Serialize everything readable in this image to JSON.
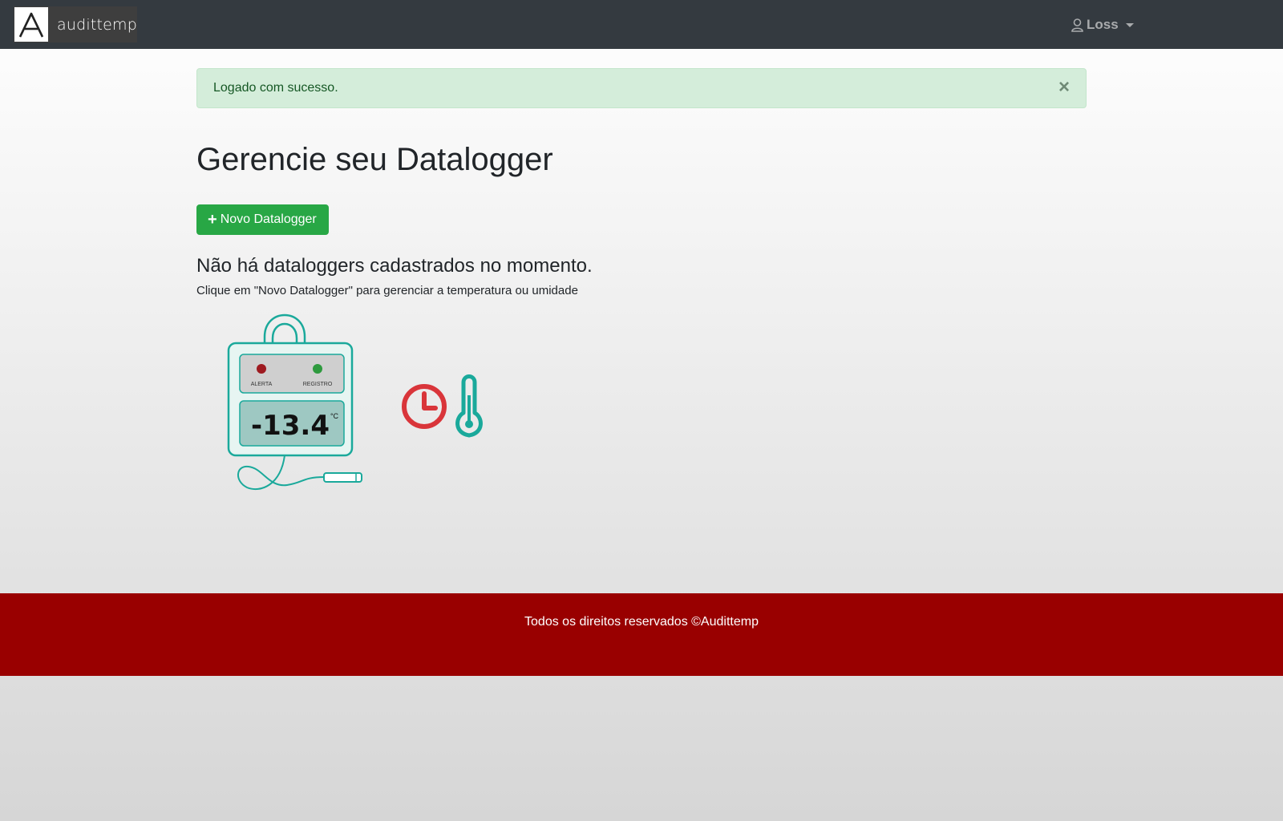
{
  "navbar": {
    "brand_name": "audittemp",
    "user_name": "Loss"
  },
  "alert": {
    "message": "Logado com sucesso.",
    "close_symbol": "×"
  },
  "main": {
    "title": "Gerencie seu Datalogger",
    "new_button_icon": "+",
    "new_button_label": "Novo Datalogger",
    "empty_title": "Não há dataloggers cadastrados no momento.",
    "empty_subtitle": "Clique em \"Novo Datalogger\" para gerenciar a temperatura ou umidade"
  },
  "illustration": {
    "alert_label": "ALERTA",
    "register_label": "REGISTRO",
    "display_value": "-13.4",
    "display_unit": "°C",
    "colors": {
      "teal": "#1aa99b",
      "red": "#d9353a",
      "green": "#2e9a3e",
      "dark_red": "#9e1a20"
    }
  },
  "footer": {
    "text": "Todos os direitos reservados ©Audittemp"
  },
  "colors": {
    "navbar": "#343a40",
    "success_button": "#28a745",
    "alert_bg": "#d4edda",
    "footer": "#990000"
  }
}
